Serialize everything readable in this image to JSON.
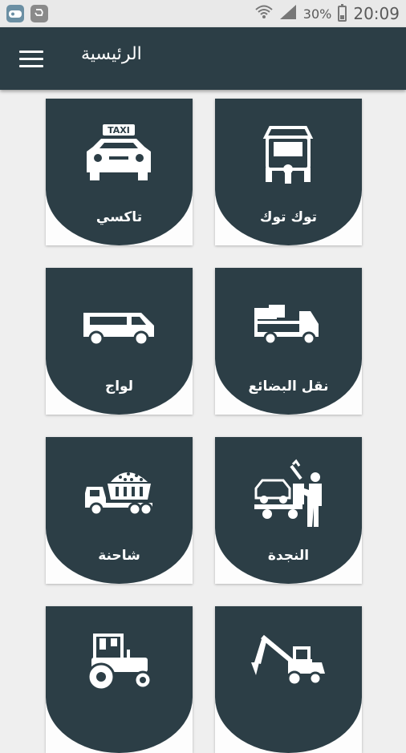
{
  "status_bar": {
    "battery": "30%",
    "time": "20:09",
    "icons": [
      "app-notification-icon",
      "recycle-icon",
      "wifi-icon",
      "signal-icon",
      "battery-icon"
    ]
  },
  "app_bar": {
    "title": "الرئيسية",
    "menu_icon": "hamburger-menu-icon"
  },
  "services": [
    {
      "label": "توك توك",
      "icon": "tuk-tuk-icon"
    },
    {
      "label": "تاكسي",
      "icon": "taxi-icon"
    },
    {
      "label": "نقل البضائع",
      "icon": "cargo-truck-icon"
    },
    {
      "label": "لواج",
      "icon": "van-icon"
    },
    {
      "label": "النجدة",
      "icon": "tow-truck-icon"
    },
    {
      "label": "شاحنة",
      "icon": "dump-truck-icon"
    },
    {
      "label": "",
      "icon": "excavator-icon"
    },
    {
      "label": "",
      "icon": "tractor-icon"
    }
  ],
  "colors": {
    "primary": "#2c3e46",
    "status_bar": "#e9e9e9",
    "background": "#efefef",
    "card": "#fdfdfd"
  }
}
